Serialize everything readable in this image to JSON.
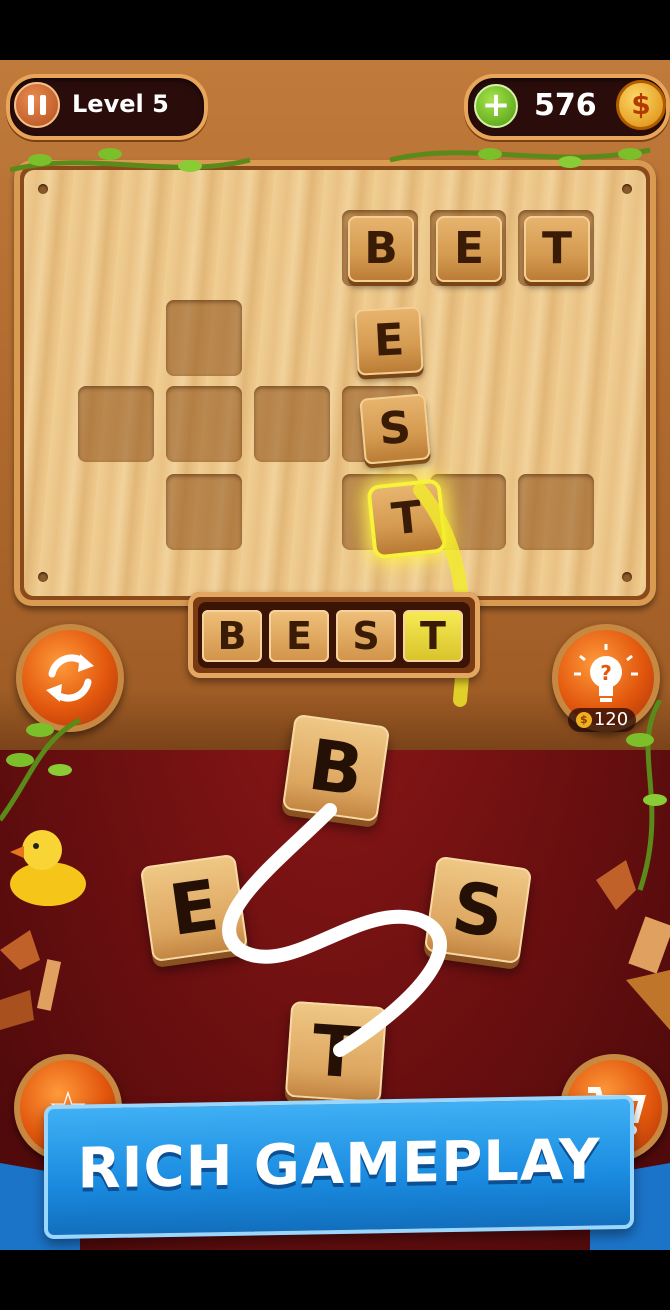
{
  "hud": {
    "level_label": "Level 5",
    "coins": "576",
    "coin_symbol": "$",
    "plus_symbol": "+"
  },
  "board": {
    "found_word": [
      "B",
      "E",
      "T"
    ],
    "vertical_letters": [
      "E",
      "S",
      "T"
    ],
    "current_word": [
      "B",
      "E",
      "S",
      "T"
    ]
  },
  "hint": {
    "cost": "120",
    "coin_symbol": "$"
  },
  "wheel_letters": [
    "B",
    "E",
    "S",
    "T"
  ],
  "banner": {
    "text": "RICH GAMEPLAY"
  },
  "colors": {
    "wood": "#c07a3b",
    "felt": "#8e1818",
    "banner": "#1a8be0",
    "highlight": "#f7f23a"
  }
}
